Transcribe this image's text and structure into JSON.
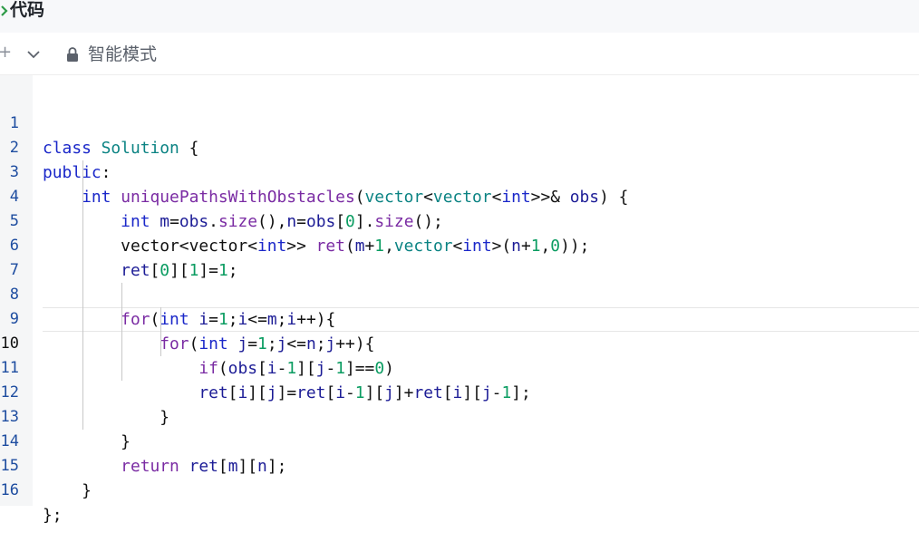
{
  "header": {
    "title": "代码"
  },
  "toolbar": {
    "plus_label": "+",
    "mode_label": "智能模式"
  },
  "code": {
    "line_numbers": [
      "1",
      "2",
      "3",
      "4",
      "5",
      "6",
      "7",
      "8",
      "9",
      "10",
      "11",
      "12",
      "13",
      "14",
      "15",
      "16"
    ],
    "active_line": "10",
    "lines": [
      "class Solution {",
      "public:",
      "    int uniquePathsWithObstacles(vector<vector<int>>& obs) {",
      "        int m=obs.size(),n=obs[0].size();",
      "        vector<vector<int>> ret(m+1,vector<int>(n+1,0));",
      "        ret[0][1]=1;",
      "",
      "        for(int i=1;i<=m;i++){",
      "            for(int j=1;j<=n;j++){",
      "                if(obs[i-1][j-1]==0)",
      "                ret[i][j]=ret[i-1][j]+ret[i][j-1];",
      "            }",
      "        }",
      "        return ret[m][n];",
      "    }",
      "};"
    ]
  },
  "colors": {
    "keyword": "#1a27c9",
    "type": "#0b8383",
    "function": "#7a2ba3",
    "number": "#0a9c61",
    "variable": "#1c1c96",
    "line_number": "#1e4da0"
  },
  "icons": [
    "chevron-right-icon",
    "chevron-down-icon",
    "lock-icon"
  ]
}
